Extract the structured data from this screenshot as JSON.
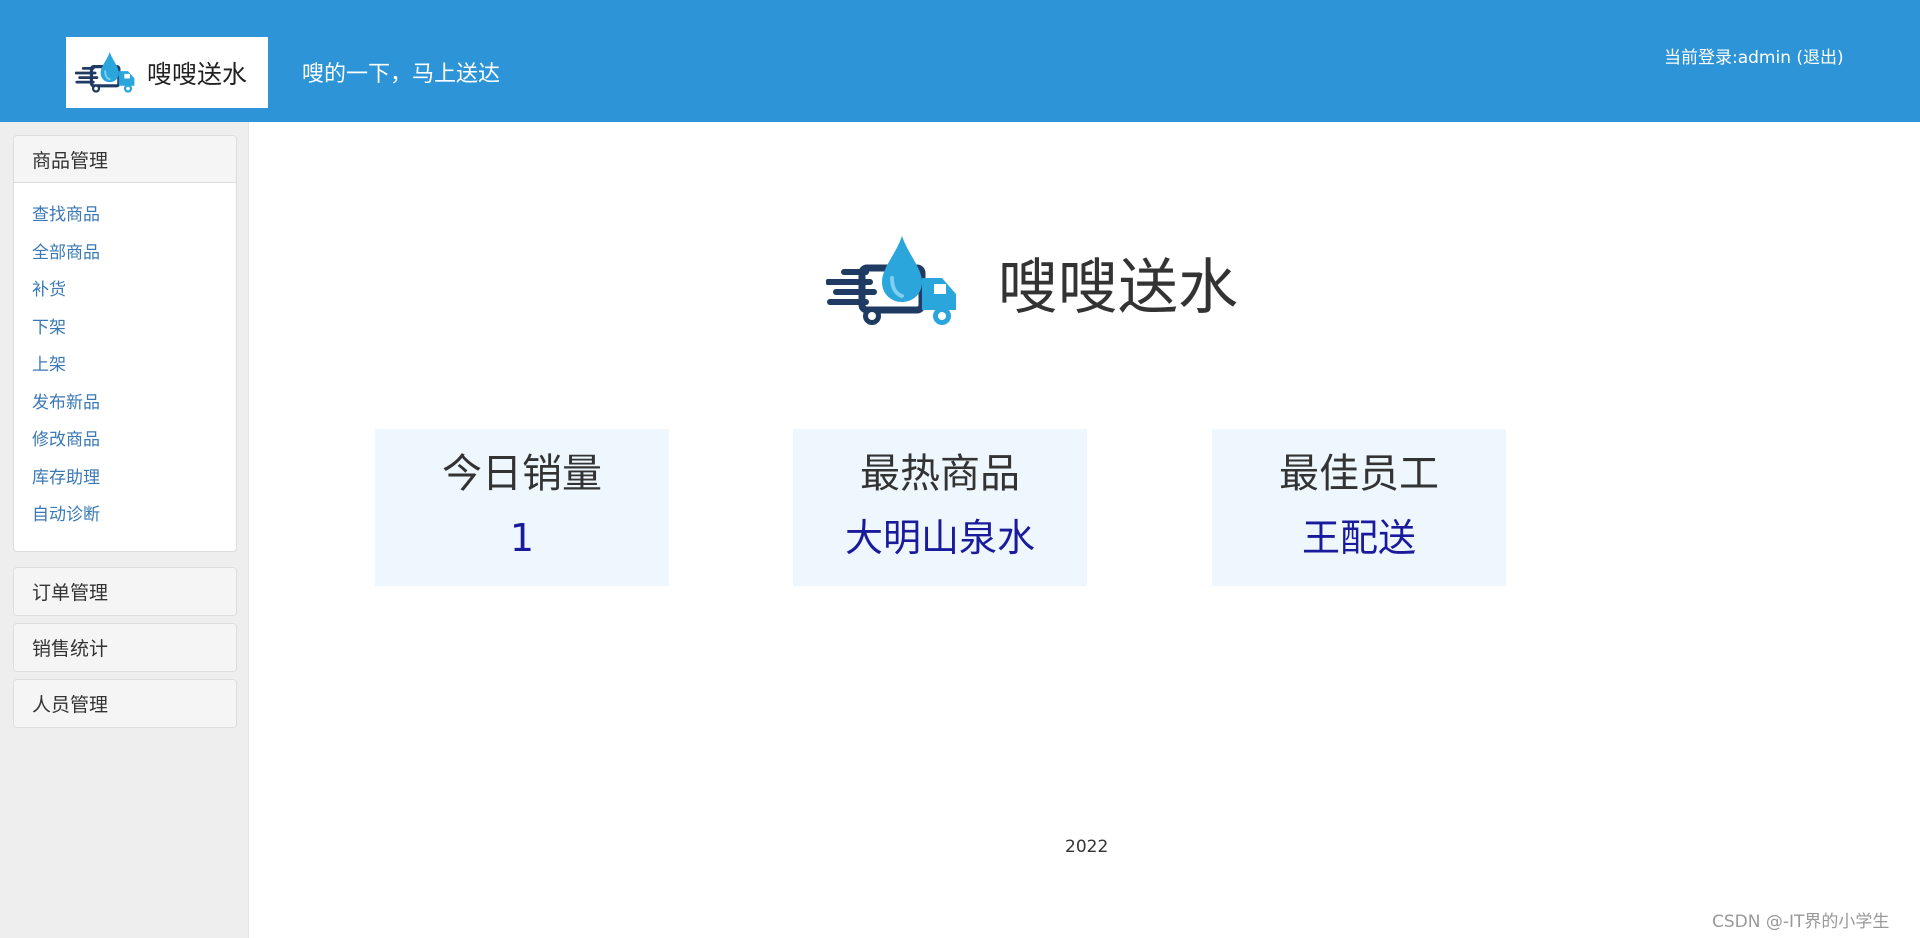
{
  "header": {
    "logo_text": "嗖嗖送水",
    "slogan": "嗖的一下，马上送达",
    "user_prefix": "当前登录:admin",
    "logout_label": "(退出)"
  },
  "sidebar": {
    "panels": [
      {
        "title": "商品管理",
        "items": [
          "查找商品",
          "全部商品",
          "补货",
          "下架",
          "上架",
          "发布新品",
          "修改商品",
          "库存助理",
          "自动诊断"
        ]
      },
      {
        "title": "订单管理"
      },
      {
        "title": "销售统计"
      },
      {
        "title": "人员管理"
      }
    ]
  },
  "main": {
    "brand_text": "嗖嗖送水",
    "cards": [
      {
        "title": "今日销量",
        "value": "1"
      },
      {
        "title": "最热商品",
        "value": "大明山泉水"
      },
      {
        "title": "最佳员工",
        "value": "王配送"
      }
    ]
  },
  "footer": {
    "year": "2022"
  },
  "watermark": "CSDN @-IT界的小学生",
  "colors": {
    "header_bg": "#2d95d7",
    "link": "#3a79b5",
    "card_bg": "#eef7fd",
    "card_value": "#1a1a9c"
  },
  "icons": {
    "logo": "water-drop-truck-icon"
  }
}
